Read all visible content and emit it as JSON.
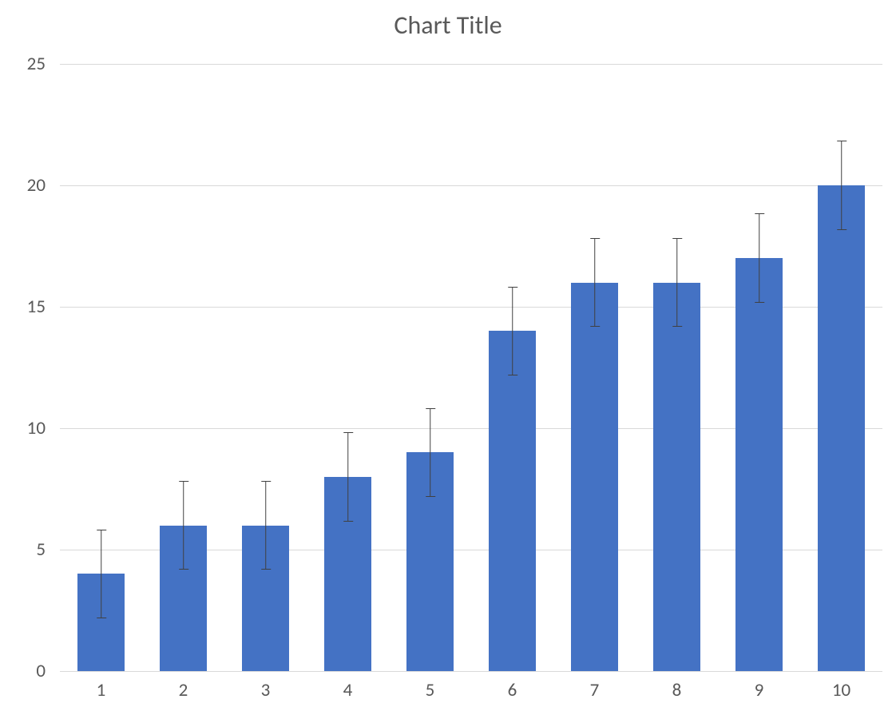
{
  "chart_data": {
    "type": "bar",
    "title": "Chart Title",
    "categories": [
      "1",
      "2",
      "3",
      "4",
      "5",
      "6",
      "7",
      "8",
      "9",
      "10"
    ],
    "values": [
      4,
      6,
      6,
      8,
      9,
      14,
      16,
      16,
      17,
      20
    ],
    "error": [
      1.8,
      1.8,
      1.8,
      1.8,
      1.8,
      1.8,
      1.8,
      1.8,
      1.8,
      1.8
    ],
    "ylim": [
      0,
      25
    ],
    "yticks": [
      0,
      5,
      10,
      15,
      20,
      25
    ],
    "bar_color": "#4472c4",
    "grid_color": "#d9d9d9"
  }
}
